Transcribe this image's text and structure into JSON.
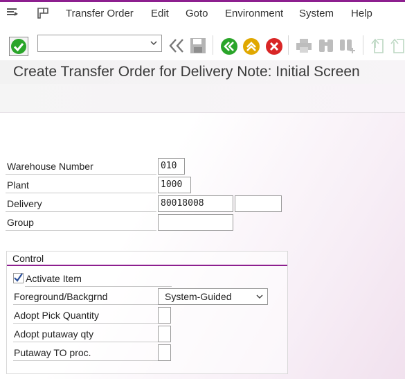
{
  "menu": {
    "items": [
      {
        "label": "Transfer Order"
      },
      {
        "label": "Edit"
      },
      {
        "label": "Goto"
      },
      {
        "label": "Environment"
      },
      {
        "label": "System"
      },
      {
        "label": "Help"
      }
    ]
  },
  "toolbar": {
    "command_value": "",
    "icons": [
      "enter-icon",
      "double-left-icon",
      "save-icon",
      "back-icon",
      "exit-icon",
      "cancel-icon",
      "print-icon",
      "find-icon",
      "find-next-icon",
      "first-page-icon",
      "previous-page-icon"
    ]
  },
  "title": "Create Transfer Order for Delivery Note: Initial Screen",
  "form": {
    "warehouse_number": {
      "label": "Warehouse Number",
      "value": "010"
    },
    "plant": {
      "label": "Plant",
      "value": "1000"
    },
    "delivery": {
      "label": "Delivery",
      "value": "80018008",
      "extra_value": ""
    },
    "group": {
      "label": "Group",
      "value": ""
    }
  },
  "control": {
    "title": "Control",
    "activate_item": {
      "label": "Activate Item",
      "checked": true
    },
    "foreground": {
      "label": "Foreground/Backgrnd",
      "value": "System-Guided"
    },
    "adopt_pick_qty": {
      "label": "Adopt Pick Quantity",
      "value": ""
    },
    "adopt_putaway_qty": {
      "label": "Adopt putaway qty",
      "value": ""
    },
    "putaway_to_proc": {
      "label": "Putaway TO proc.",
      "value": ""
    }
  },
  "colors": {
    "accent": "#8d1f8f",
    "ok_green": "#2aa52a",
    "exit_yellow": "#e0a800",
    "cancel_red": "#d92626"
  }
}
